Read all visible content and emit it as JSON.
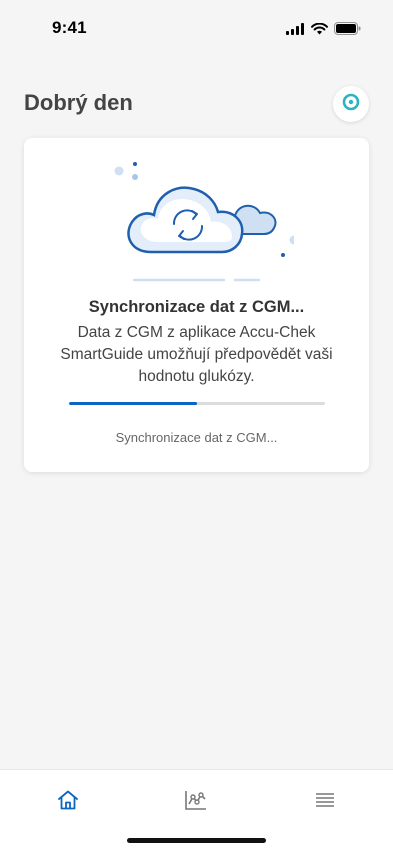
{
  "status_bar": {
    "time": "9:41",
    "icons": [
      "signal-icon",
      "wifi-icon",
      "battery-icon"
    ]
  },
  "header": {
    "title": "Dobrý den",
    "sensor_icon": "sensor-ring-icon"
  },
  "sync_card": {
    "illustration": "cloud-sync-icon",
    "title": "Synchronizace dat z CGM...",
    "description": "Data z CGM z aplikace Accu-Chek SmartGuide umožňují předpovědět vaši hodnotu glukózy.",
    "progress_fraction": 0.5,
    "status_text": "Synchronizace dat z CGM..."
  },
  "bottom_nav": {
    "items": [
      {
        "icon": "home-icon",
        "active": true
      },
      {
        "icon": "chart-icon",
        "active": false
      },
      {
        "icon": "menu-icon",
        "active": false
      }
    ]
  },
  "colors": {
    "accent": "#0a66c2",
    "sensor_teal": "#2bb3c0",
    "background": "#f5f5f5"
  }
}
